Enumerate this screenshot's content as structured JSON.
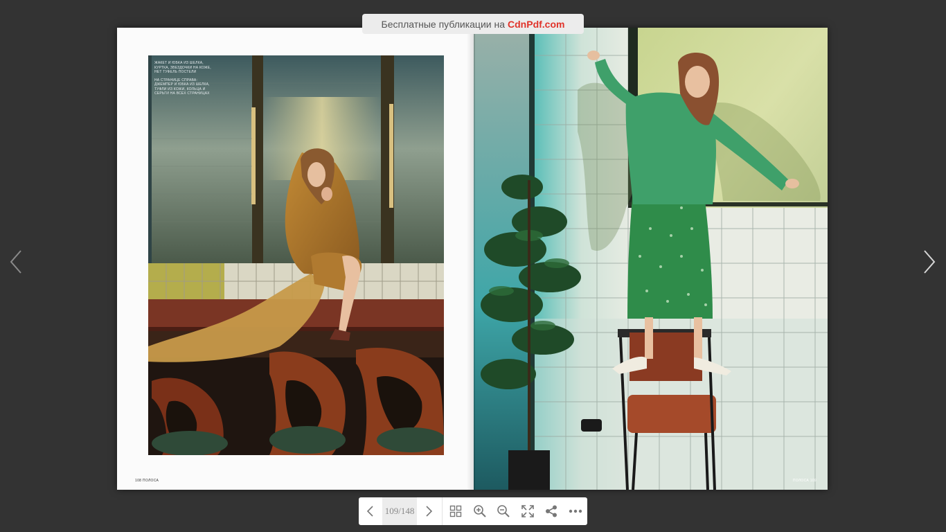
{
  "banner": {
    "prefix": "Бесплатные публикации на",
    "brand": "CdnPdf.com"
  },
  "navigation": {
    "prev_icon": "chevron-left-icon",
    "next_icon": "chevron-right-icon"
  },
  "pages": {
    "left": {
      "caption_lines_1": "ЖАКЕТ И ЮБКА ИЗ ШЕЛКА, КУРТКА, ЗВЕЗДОЧКИ НА КОЖЕ, НЕТ ТУФЕЛЬ ПОСТЕЛИ",
      "caption_lines_2": "НА СТРАНИЦЕ СПРАВА: ДЖЕМПЕР И ЮБКА ИЗ ШЕЛКА, ТУФЛИ ИЗ КОЖИ, КОЛЬЦА И СЕРЬГИ НА ВСЕХ СТРАНИЦАХ",
      "folio": "108 ПОЛОСА"
    },
    "right": {
      "folio": "ПОЛОСА 109"
    }
  },
  "toolbar": {
    "page_indicator": "109/148",
    "buttons": [
      {
        "name": "prev-page-button",
        "icon": "chevron-left-icon"
      },
      {
        "name": "next-page-button",
        "icon": "chevron-right-icon"
      },
      {
        "name": "thumbnails-button",
        "icon": "grid-icon"
      },
      {
        "name": "zoom-in-button",
        "icon": "zoom-in-icon"
      },
      {
        "name": "zoom-out-button",
        "icon": "zoom-out-icon"
      },
      {
        "name": "fullscreen-button",
        "icon": "fullscreen-icon"
      },
      {
        "name": "share-button",
        "icon": "share-icon"
      },
      {
        "name": "more-button",
        "icon": "more-icon"
      }
    ]
  },
  "colors": {
    "background": "#333333",
    "brand": "#e0332a",
    "toolbar_icon": "#777777"
  }
}
